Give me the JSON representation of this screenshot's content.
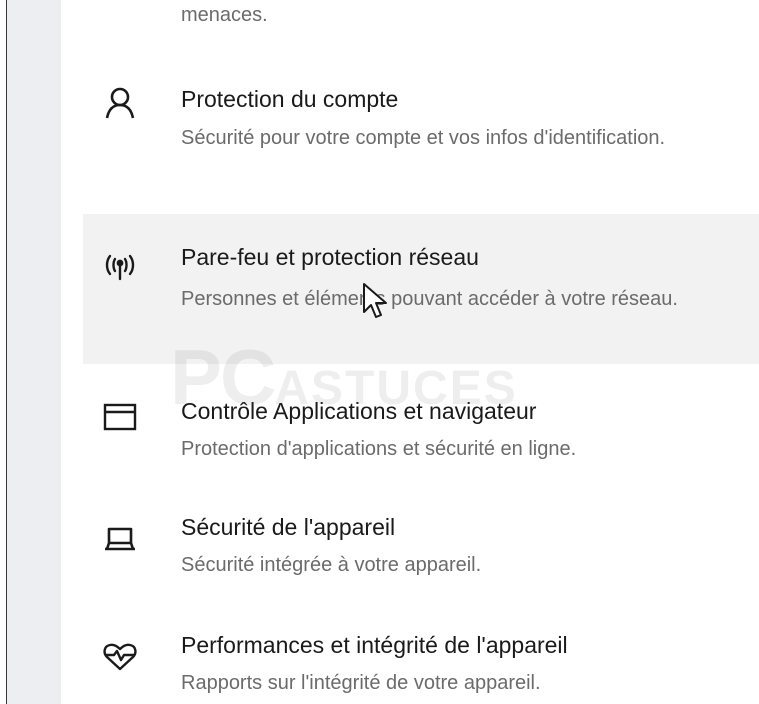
{
  "previous_item": {
    "desc_tail": "menaces."
  },
  "items": [
    {
      "icon": "person-icon",
      "title": "Protection du compte",
      "desc": "Sécurité pour votre compte et vos infos d'identification."
    },
    {
      "icon": "antenna-icon",
      "title": "Pare-feu et protection réseau",
      "desc": "Personnes et éléments pouvant accéder à votre réseau."
    },
    {
      "icon": "browser-window-icon",
      "title": "Contrôle Applications et navigateur",
      "desc": "Protection d'applications et sécurité en ligne."
    },
    {
      "icon": "laptop-icon",
      "title": "Sécurité de l'appareil",
      "desc": "Sécurité intégrée à votre appareil."
    },
    {
      "icon": "heart-pulse-icon",
      "title": "Performances et intégrité de l'appareil",
      "desc": "Rapports sur l'intégrité de votre appareil."
    }
  ],
  "watermark": {
    "brand": "PC",
    "brand_suffix": "ASTUCES"
  },
  "colors": {
    "hover_bg": "#f2f2f2",
    "title_text": "#1a1a1a",
    "desc_text": "#6b6b6b",
    "left_strip": "#eceef1"
  }
}
